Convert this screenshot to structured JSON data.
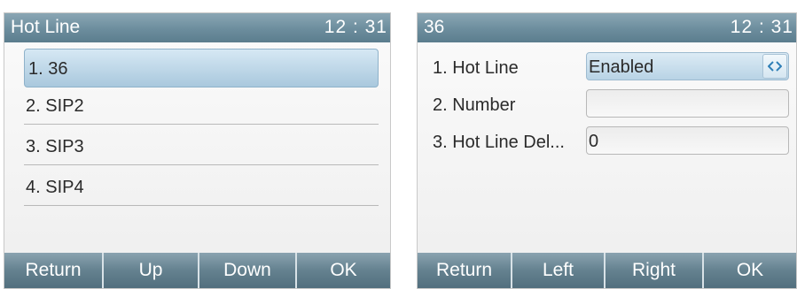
{
  "left_screen": {
    "title": "Hot Line",
    "clock": "12 : 31",
    "items": [
      {
        "label": "1. 36",
        "selected": true
      },
      {
        "label": "2. SIP2",
        "selected": false
      },
      {
        "label": "3. SIP3",
        "selected": false
      },
      {
        "label": "4. SIP4",
        "selected": false
      }
    ],
    "softkeys": [
      "Return",
      "Up",
      "Down",
      "OK"
    ]
  },
  "right_screen": {
    "title": "36",
    "clock": "12 : 31",
    "rows": [
      {
        "label": "1. Hot Line",
        "value": "Enabled",
        "type": "select"
      },
      {
        "label": "2. Number",
        "value": "",
        "type": "text"
      },
      {
        "label": "3. Hot Line Del...",
        "value": "0",
        "type": "text"
      }
    ],
    "softkeys": [
      "Return",
      "Left",
      "Right",
      "OK"
    ]
  },
  "colors": {
    "title_bar": "#6c8d9d",
    "selection": "#a9c8dd"
  },
  "icons": {
    "select_arrows": "left-right-arrows-icon"
  }
}
